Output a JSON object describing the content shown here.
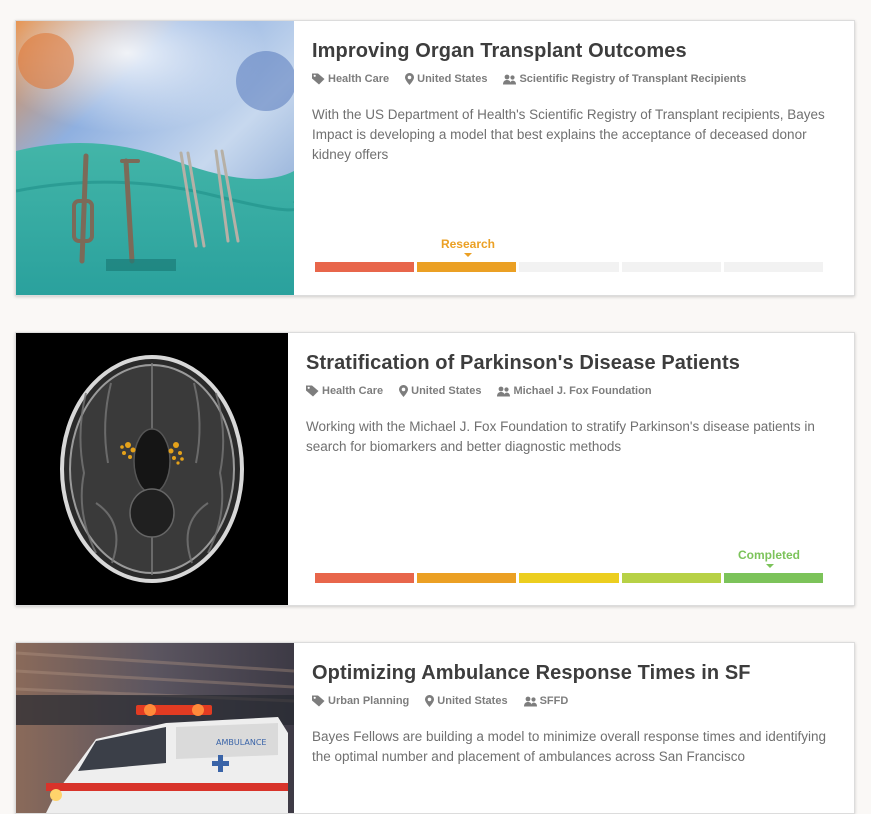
{
  "projects": [
    {
      "title": "Improving Organ Transplant Outcomes",
      "category": "Health Care",
      "location": "United States",
      "partner": "Scientific Registry of Transplant Recipients",
      "description": "With the US Department of Health's Scientific Registry of Transplant recipients, Bayes Impact is developing a model that best explains the acceptance of deceased donor kidney offers",
      "stage": "Research",
      "stage_index": 1,
      "stage_color": "#eba024",
      "segment_colors": [
        "#e8664b",
        "#eba024",
        "#f2f2f2",
        "#f2f2f2",
        "#f2f2f2"
      ],
      "image": "surgical-instruments-photo"
    },
    {
      "title": "Stratification of Parkinson's Disease Patients",
      "category": "Health Care",
      "location": "United States",
      "partner": "Michael J. Fox Foundation",
      "description": "Working with the Michael J. Fox Foundation to stratify Parkinson's disease patients in search for biomarkers and better diagnostic methods",
      "stage": "Completed",
      "stage_index": 4,
      "stage_color": "#7cc35a",
      "segment_colors": [
        "#e8664b",
        "#eba024",
        "#ecce1f",
        "#b7d146",
        "#7cc35a"
      ],
      "image": "brain-mri-photo"
    },
    {
      "title": "Optimizing Ambulance Response Times in SF",
      "category": "Urban Planning",
      "location": "United States",
      "partner": "SFFD",
      "description": "Bayes Fellows are building a model to minimize overall response times and identifying the optimal number and placement of ambulances across San Francisco",
      "image": "ambulance-photo"
    }
  ],
  "icons": {
    "category": "tag-icon",
    "location": "map-marker-icon",
    "partner": "users-icon"
  },
  "colors": {
    "title": "#3d3d3d",
    "meta": "#7d7d7d",
    "description": "#707070",
    "background": "#faf8f6"
  }
}
